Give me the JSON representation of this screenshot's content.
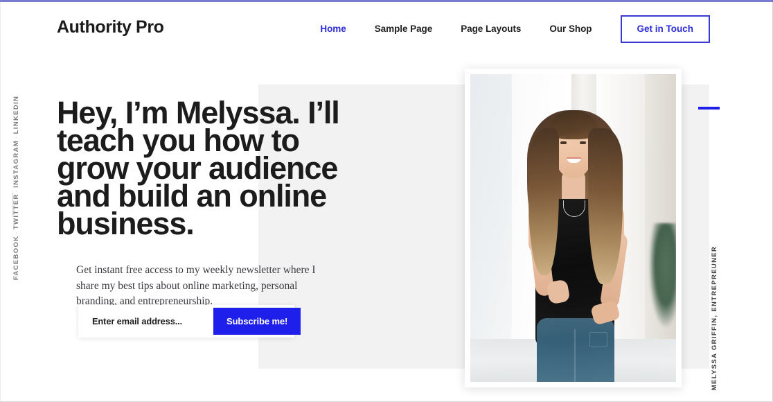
{
  "site": {
    "logo_text": "Authority Pro",
    "accent_color": "#2b2bd8",
    "button_color": "#1f1fec",
    "heading_color": "#1c1c1c",
    "panel_gray": "#f2f2f2",
    "frame_border_color": "#7b7bd2"
  },
  "nav": {
    "items": [
      {
        "label": "Home",
        "active": true
      },
      {
        "label": "Sample Page",
        "active": false
      },
      {
        "label": "Page Layouts",
        "active": false
      },
      {
        "label": "Our Shop",
        "active": false
      }
    ],
    "cta_label": "Get in Touch"
  },
  "social_rail": {
    "items": [
      "FACEBOOK",
      "TWITTER",
      "INSTAGRAM",
      "LINKEDIN"
    ],
    "separator": "·",
    "full_text": "FACEBOOK · TWITTER · INSTAGRAM · LINKEDIN"
  },
  "hero": {
    "heading": "Hey, I’m Melyssa. I’ll teach you how to grow your audience and build an online business.",
    "subtext": "Get instant free access to my weekly newsletter where I share my best tips about online marketing, personal branding, and entrepreneurship.",
    "form": {
      "email_placeholder": "Enter email address...",
      "email_value": "",
      "submit_label": "Subscribe me!"
    },
    "portrait_alt": "Smiling woman in black sleeveless top and blue jeans standing in a bright hallway"
  },
  "credit_rail": {
    "text": "MELYSSA GRIFFIN, ENTREPREUNER"
  }
}
